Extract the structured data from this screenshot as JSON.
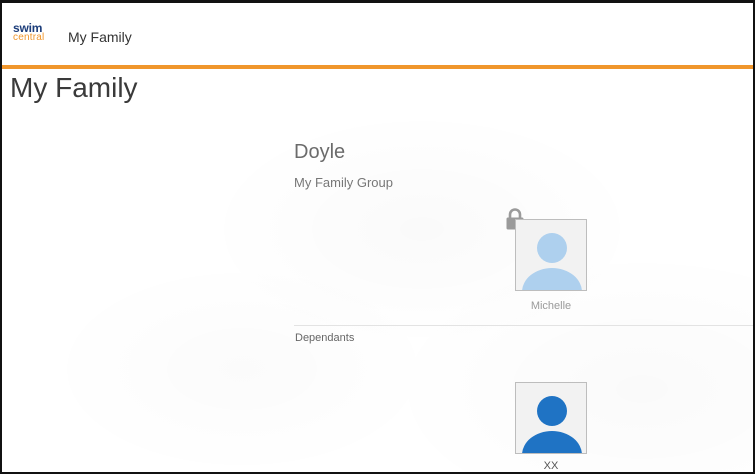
{
  "header": {
    "logo_line1": "swim",
    "logo_line2": "central",
    "title": "My Family"
  },
  "page": {
    "title": "My Family"
  },
  "family": {
    "name": "Doyle",
    "group_label": "My Family Group",
    "members": [
      {
        "name": "Michelle",
        "locked": true,
        "avatar_color": "#aed0ee"
      }
    ],
    "dependants_label": "Dependants",
    "dependants": [
      {
        "name": "XX",
        "avatar_color": "#1f73c4"
      }
    ]
  },
  "colors": {
    "accent": "#f0962c",
    "brand_navy": "#1c3d7a"
  },
  "icons": [
    "lock-icon",
    "person-avatar-icon"
  ]
}
